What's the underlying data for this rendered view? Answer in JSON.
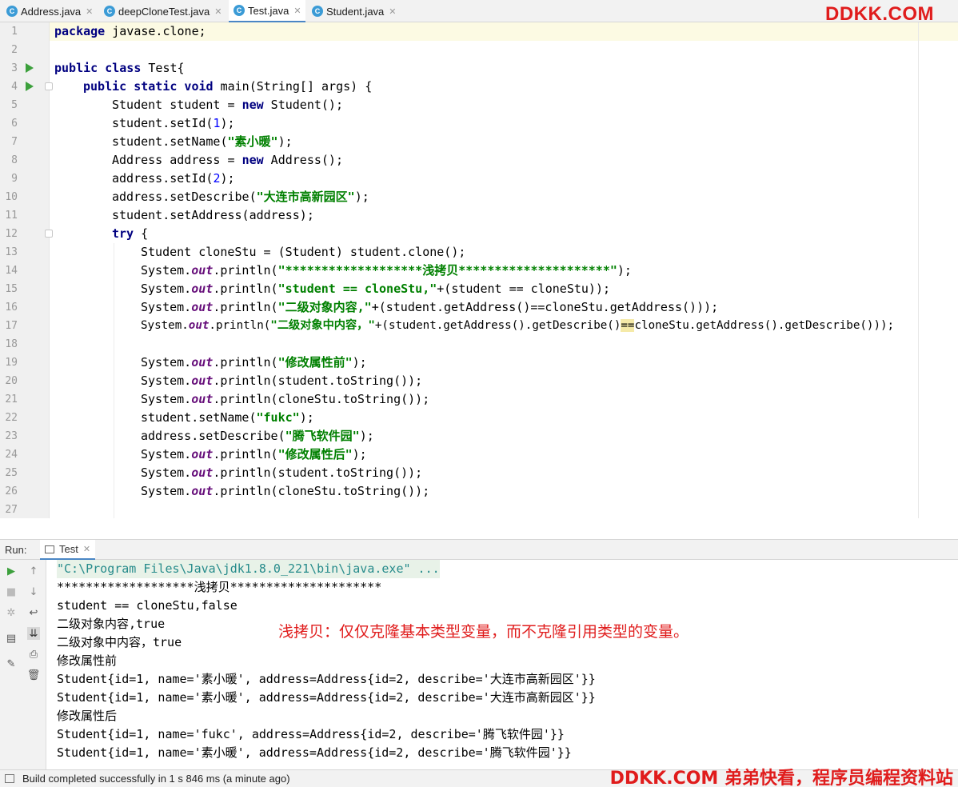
{
  "tabs": [
    {
      "label": "Address.java",
      "icon": "class-icon"
    },
    {
      "label": "deepCloneTest.java",
      "icon": "class-icon"
    },
    {
      "label": "Test.java",
      "icon": "class-icon",
      "active": true
    },
    {
      "label": "Student.java",
      "icon": "class-icon"
    }
  ],
  "watermark_top": "DDKK.COM",
  "editor": {
    "line_numbers": [
      "1",
      "2",
      "3",
      "4",
      "5",
      "6",
      "7",
      "8",
      "9",
      "10",
      "11",
      "12",
      "13",
      "14",
      "15",
      "16",
      "17",
      "18",
      "19",
      "20",
      "21",
      "22",
      "23",
      "24",
      "25",
      "26",
      "27"
    ],
    "code": {
      "l1_kw": "package",
      "l1_rest": " javase.clone;",
      "l3_kw": "public class",
      "l3_rest": " Test{",
      "l4_kw": "public static void",
      "l4_rest": " main(String[] args) {",
      "l5_a": "Student student = ",
      "l5_kw": "new",
      "l5_b": " Student();",
      "l6_a": "student.setId(",
      "l6_num": "1",
      "l6_b": ");",
      "l7_a": "student.setName(",
      "l7_str": "\"素小暖\"",
      "l7_b": ");",
      "l8_a": "Address address = ",
      "l8_kw": "new",
      "l8_b": " Address();",
      "l9_a": "address.setId(",
      "l9_num": "2",
      "l9_b": ");",
      "l10_a": "address.setDescribe(",
      "l10_str": "\"大连市高新园区\"",
      "l10_b": ");",
      "l11": "student.setAddress(address);",
      "l12_kw": "try",
      "l12_rest": " {",
      "l13": "Student cloneStu = (Student) student.clone();",
      "sys": "System.",
      "out": "out",
      "l14_a": ".println(",
      "l14_str": "\"*******************浅拷贝*********************\"",
      "l14_b": ");",
      "l15_a": ".println(",
      "l15_str": "\"student == cloneStu,\"",
      "l15_b": "+(student == cloneStu));",
      "l16_a": ".println(",
      "l16_str": "\"二级对象内容,\"",
      "l16_b": "+(student.getAddress()==cloneStu.getAddress()));",
      "l17_a": ".println(",
      "l17_str": "\"二级对象中内容，\"",
      "l17_b": "+(student.getAddress().getDescribe()",
      "l17_hl": "==",
      "l17_c": "cloneStu.getAddress().getDescribe()));",
      "l19_a": ".println(",
      "l19_str": "\"修改属性前\"",
      "l19_b": ");",
      "l20_a": ".println(student.toString());",
      "l21_a": ".println(cloneStu.toString());",
      "l22_a": "student.setName(",
      "l22_str": "\"fukc\"",
      "l22_b": ");",
      "l23_a": "address.setDescribe(",
      "l23_str": "\"腾飞软件园\"",
      "l23_b": ");",
      "l24_a": ".println(",
      "l24_str": "\"修改属性后\"",
      "l24_b": ");",
      "l25_a": ".println(student.toString());",
      "l26_a": ".println(cloneStu.toString());"
    }
  },
  "run_panel": {
    "label": "Run:",
    "tab_label": "Test",
    "output": [
      "\"C:\\Program Files\\Java\\jdk1.8.0_221\\bin\\java.exe\" ...",
      "*******************浅拷贝*********************",
      "student == cloneStu,false",
      "二级对象内容,true",
      "二级对象中内容，true",
      "修改属性前",
      "Student{id=1, name='素小暖', address=Address{id=2, describe='大连市高新园区'}}",
      "Student{id=1, name='素小暖', address=Address{id=2, describe='大连市高新园区'}}",
      "修改属性后",
      "Student{id=1, name='fukc', address=Address{id=2, describe='腾飞软件园'}}",
      "Student{id=1, name='素小暖', address=Address{id=2, describe='腾飞软件园'}}"
    ],
    "annotation": "浅拷贝：仅仅克隆基本类型变量，而不克隆引用类型的变量。",
    "toolbar_icons": [
      "run-icon",
      "up-arrow-icon",
      "stop-icon",
      "down-arrow-icon",
      "debug-icon",
      "soft-wrap-icon",
      "layout-icon",
      "scroll-to-end-icon",
      "print-icon",
      "pin-icon",
      "trash-icon"
    ]
  },
  "status": {
    "text": "Build completed successfully in 1 s 846 ms (a minute ago)",
    "watermark": "DDKK.COM 弟弟快看，程序员编程资料站"
  },
  "colors": {
    "keyword": "#000080",
    "string": "#008000",
    "number": "#0000ff",
    "static_field": "#660e7a",
    "watermark": "#e01c1c",
    "tab_active_underline": "#4a86c5"
  }
}
